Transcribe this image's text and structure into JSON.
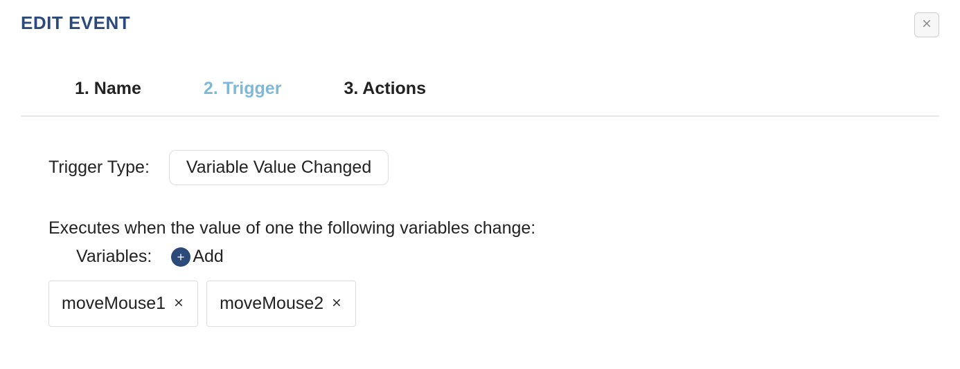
{
  "dialog": {
    "title": "EDIT EVENT"
  },
  "tabs": [
    {
      "label": "1. Name",
      "active": false
    },
    {
      "label": "2. Trigger",
      "active": true
    },
    {
      "label": "3. Actions",
      "active": false
    }
  ],
  "trigger": {
    "type_label": "Trigger Type:",
    "type_value": "Variable Value Changed",
    "description": "Executes when the value of one the following variables change:",
    "variables_label": "Variables:",
    "add_label": "Add",
    "variables": [
      {
        "name": "moveMouse1"
      },
      {
        "name": "moveMouse2"
      }
    ]
  }
}
